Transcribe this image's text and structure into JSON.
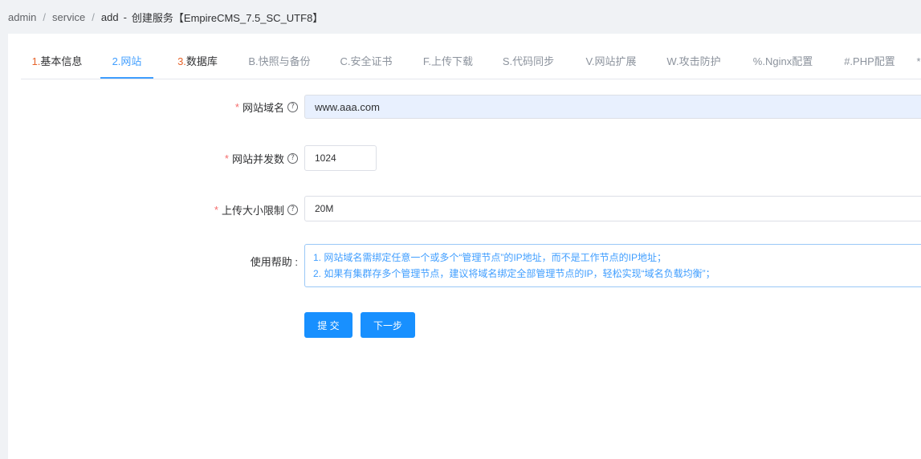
{
  "breadcrumb": {
    "items": [
      "admin",
      "service",
      "add"
    ],
    "separator": "/",
    "dash": "-",
    "page_title": "创建服务【EmpireCMS_7.5_SC_UTF8】"
  },
  "tabs": [
    {
      "num": "1.",
      "text": "基本信息"
    },
    {
      "num": "2.",
      "text": "网站"
    },
    {
      "num": "3.",
      "text": "数据库"
    },
    {
      "num": "B.",
      "text": "快照与备份"
    },
    {
      "num": "C.",
      "text": "安全证书"
    },
    {
      "num": "F.",
      "text": "上传下载"
    },
    {
      "num": "S.",
      "text": "代码同步"
    },
    {
      "num": "V.",
      "text": "网站扩展"
    },
    {
      "num": "W.",
      "text": "攻击防护"
    },
    {
      "num": "%.",
      "text": "Nginx配置"
    },
    {
      "num": "#.",
      "text": "PHP配置"
    },
    {
      "num": "*",
      "text": ""
    }
  ],
  "form": {
    "domain": {
      "label": "网站域名",
      "value": "www.aaa.com"
    },
    "concurrency": {
      "label": "网站并发数",
      "value": "1024"
    },
    "upload_limit": {
      "label": "上传大小限制",
      "value": "20M"
    },
    "help": {
      "label": "使用帮助 :",
      "lines": [
        "1. 网站域名需绑定任意一个或多个“管理节点”的IP地址，而不是工作节点的IP地址；",
        "2. 如果有集群存多个管理节点，建议将域名绑定全部管理节点的IP，轻松实现“域名负载均衡”；"
      ]
    },
    "required_mark": "*",
    "help_icon_glyph": "?"
  },
  "buttons": {
    "submit": "提 交",
    "next": "下一步"
  },
  "colors": {
    "accent": "#409eff",
    "tab_number": "#e6632a",
    "required": "#f56c6c",
    "button": "#1890ff"
  }
}
